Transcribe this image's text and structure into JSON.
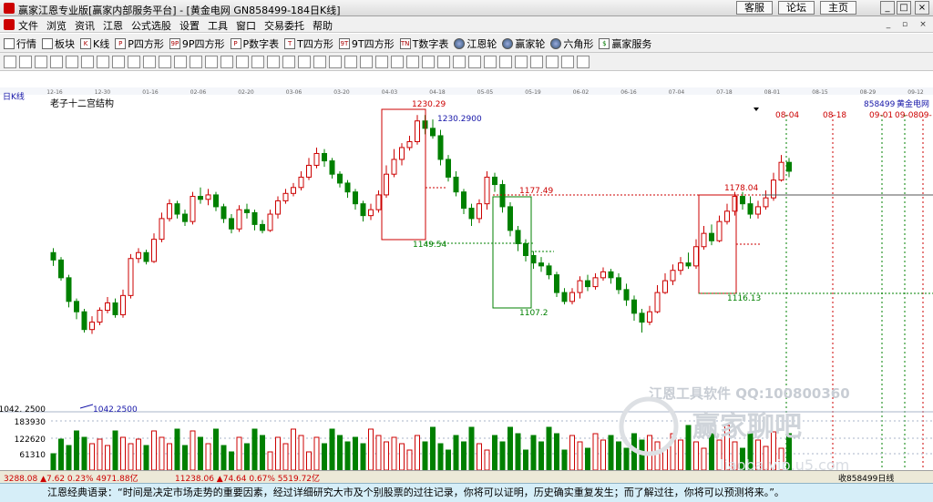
{
  "window": {
    "title": "赢家江恩专业版[赢家内部服务平台] - [黄金电网  GN858499-184日K线]",
    "links": [
      "客服",
      "论坛",
      "主页"
    ],
    "controls": [
      "_",
      "□",
      "×"
    ]
  },
  "menu": {
    "items": [
      "文件",
      "浏览",
      "资讯",
      "江恩",
      "公式选股",
      "设置",
      "工具",
      "窗口",
      "交易委托",
      "帮助"
    ],
    "controls": [
      "_",
      "▫",
      "×"
    ]
  },
  "toolbar": {
    "items": [
      {
        "icon": "grid-icon",
        "label": "行情"
      },
      {
        "icon": "grid-icon",
        "label": "板块"
      },
      {
        "icon": "kline-icon",
        "label": "K线"
      },
      {
        "icon": "p-square-icon",
        "label": "P四方形"
      },
      {
        "icon": "9p-square-icon",
        "label": "9P四方形"
      },
      {
        "icon": "p-digit-icon",
        "label": "P数字表"
      },
      {
        "icon": "t-square-icon",
        "label": "T四方形"
      },
      {
        "icon": "9t-square-icon",
        "label": "9T四方形"
      },
      {
        "icon": "tn-digit-icon",
        "label": "T数字表"
      },
      {
        "icon": "wheel-icon",
        "label": "江恩轮"
      },
      {
        "icon": "wheel-icon",
        "label": "赢家轮"
      },
      {
        "icon": "hexagon-icon",
        "label": "六角形"
      },
      {
        "icon": "dollar-icon",
        "label": "赢家服务"
      }
    ]
  },
  "chart": {
    "period_label": "日K线",
    "pattern_label": "老子十二宫结构",
    "symbol": "858499",
    "name": "黄金电网",
    "top_dates": [
      "12-16",
      "12-30",
      "01-16",
      "02-06",
      "02-20",
      "03-06",
      "03-20",
      "04-03",
      "04-18",
      "05-05",
      "05-19",
      "06-02",
      "06-16",
      "07-04",
      "07-18",
      "08-01",
      "08-15",
      "08-29",
      "09-12"
    ],
    "future_dates": [
      "08-04",
      "08-18",
      "09-01",
      "09-08",
      "09-"
    ],
    "price_labels": {
      "high": "1230.29",
      "high2": "1230.2900",
      "low1": "1149.54",
      "mid": "1177.49",
      "low2": "1107.2",
      "right_high": "1178.04",
      "right_low": "1116.13",
      "bottom": "1042.2500",
      "bottom_axis": "1042. 2500"
    },
    "volume_axis": [
      "183930",
      "122620",
      "61310"
    ],
    "watermark": [
      "江恩工具软件  QQ:100800360",
      "赢家聊吧",
      "liaoba.vip.u5.com"
    ]
  },
  "statusbar": {
    "index1": "3288.08 ▲7.62 0.23% 4971.88亿",
    "index2": "11238.06 ▲74.64 0.67% 5519.72亿",
    "right": "收858499日线"
  },
  "quote": {
    "text": "江恩经典语录：“时间是决定市场走势的重要因素，经过详细研究大市及个别股票的过往记录，你将可以证明，历史确实重复发生；而了解过往，你将可以预测将来。”。"
  },
  "colors": {
    "up": "#cc0000",
    "down": "#008000",
    "grid": "#aab4c8",
    "highlight": "#1515a8"
  },
  "chart_data": {
    "type": "candlestick",
    "series": [
      {
        "name": "K线",
        "values": [
          [
            1137,
            1132,
            1140,
            1128
          ],
          [
            1132,
            1120,
            1134,
            1118
          ],
          [
            1120,
            1104,
            1122,
            1100
          ],
          [
            1104,
            1097,
            1106,
            1092
          ],
          [
            1097,
            1085,
            1099,
            1083
          ],
          [
            1085,
            1090,
            1094,
            1082
          ],
          [
            1090,
            1098,
            1100,
            1088
          ],
          [
            1098,
            1103,
            1107,
            1096
          ],
          [
            1103,
            1095,
            1106,
            1093
          ],
          [
            1095,
            1108,
            1112,
            1093
          ],
          [
            1108,
            1133,
            1136,
            1106
          ],
          [
            1133,
            1137,
            1140,
            1130
          ],
          [
            1137,
            1131,
            1139,
            1129
          ],
          [
            1131,
            1146,
            1150,
            1130
          ],
          [
            1146,
            1160,
            1164,
            1144
          ],
          [
            1160,
            1170,
            1173,
            1158
          ],
          [
            1170,
            1163,
            1172,
            1160
          ],
          [
            1163,
            1158,
            1166,
            1155
          ],
          [
            1158,
            1175,
            1178,
            1156
          ],
          [
            1175,
            1173,
            1181,
            1170
          ],
          [
            1173,
            1176,
            1180,
            1169
          ],
          [
            1176,
            1168,
            1178,
            1165
          ],
          [
            1168,
            1160,
            1170,
            1157
          ],
          [
            1160,
            1153,
            1163,
            1150
          ],
          [
            1153,
            1166,
            1169,
            1151
          ],
          [
            1166,
            1164,
            1170,
            1160
          ],
          [
            1164,
            1156,
            1166,
            1152
          ],
          [
            1156,
            1152,
            1159,
            1150
          ],
          [
            1152,
            1163,
            1166,
            1151
          ],
          [
            1163,
            1172,
            1175,
            1160
          ],
          [
            1172,
            1177,
            1180,
            1170
          ],
          [
            1177,
            1181,
            1184,
            1175
          ],
          [
            1181,
            1188,
            1192,
            1179
          ],
          [
            1188,
            1196,
            1201,
            1186
          ],
          [
            1196,
            1204,
            1208,
            1194
          ],
          [
            1204,
            1199,
            1207,
            1195
          ],
          [
            1199,
            1190,
            1201,
            1187
          ],
          [
            1190,
            1184,
            1192,
            1181
          ],
          [
            1184,
            1178,
            1186,
            1174
          ],
          [
            1178,
            1170,
            1180,
            1166
          ],
          [
            1170,
            1162,
            1172,
            1158
          ],
          [
            1162,
            1166,
            1170,
            1159
          ],
          [
            1166,
            1176,
            1179,
            1164
          ],
          [
            1176,
            1190,
            1196,
            1174
          ],
          [
            1190,
            1200,
            1207,
            1188
          ],
          [
            1200,
            1208,
            1211,
            1196
          ],
          [
            1208,
            1212,
            1216,
            1206
          ],
          [
            1212,
            1226,
            1230,
            1210
          ],
          [
            1226,
            1221,
            1230,
            1217
          ],
          [
            1221,
            1216,
            1227,
            1214
          ],
          [
            1216,
            1200,
            1220,
            1196
          ],
          [
            1200,
            1188,
            1203,
            1185
          ],
          [
            1188,
            1178,
            1192,
            1175
          ],
          [
            1178,
            1167,
            1180,
            1163
          ],
          [
            1167,
            1160,
            1170,
            1155
          ],
          [
            1160,
            1170,
            1173,
            1157
          ],
          [
            1170,
            1188,
            1192,
            1166
          ],
          [
            1188,
            1183,
            1191,
            1178
          ],
          [
            1183,
            1168,
            1186,
            1164
          ],
          [
            1168,
            1152,
            1171,
            1148
          ],
          [
            1152,
            1143,
            1155,
            1138
          ],
          [
            1143,
            1135,
            1146,
            1131
          ],
          [
            1135,
            1130,
            1138,
            1126
          ],
          [
            1130,
            1128,
            1134,
            1124
          ],
          [
            1128,
            1122,
            1130,
            1119
          ],
          [
            1122,
            1110,
            1124,
            1107
          ],
          [
            1110,
            1104,
            1113,
            1102
          ],
          [
            1104,
            1110,
            1113,
            1102
          ],
          [
            1110,
            1118,
            1121,
            1106
          ],
          [
            1118,
            1114,
            1122,
            1111
          ],
          [
            1114,
            1120,
            1123,
            1112
          ],
          [
            1120,
            1124,
            1127,
            1118
          ],
          [
            1124,
            1120,
            1126,
            1116
          ],
          [
            1120,
            1112,
            1123,
            1109
          ],
          [
            1112,
            1105,
            1116,
            1101
          ],
          [
            1105,
            1096,
            1108,
            1091
          ],
          [
            1096,
            1090,
            1099,
            1083
          ],
          [
            1090,
            1097,
            1101,
            1088
          ],
          [
            1097,
            1110,
            1115,
            1096
          ],
          [
            1110,
            1118,
            1123,
            1109
          ],
          [
            1118,
            1125,
            1129,
            1115
          ],
          [
            1125,
            1130,
            1134,
            1122
          ],
          [
            1130,
            1128,
            1137,
            1126
          ],
          [
            1128,
            1141,
            1146,
            1126
          ],
          [
            1141,
            1150,
            1155,
            1139
          ],
          [
            1150,
            1145,
            1156,
            1142
          ],
          [
            1145,
            1158,
            1162,
            1144
          ],
          [
            1158,
            1165,
            1170,
            1156
          ],
          [
            1165,
            1175,
            1178,
            1162
          ],
          [
            1175,
            1170,
            1178,
            1166
          ],
          [
            1170,
            1163,
            1175,
            1160
          ],
          [
            1163,
            1168,
            1172,
            1160
          ],
          [
            1168,
            1174,
            1179,
            1166
          ],
          [
            1174,
            1186,
            1191,
            1172
          ],
          [
            1186,
            1198,
            1203,
            1185
          ],
          [
            1198,
            1192,
            1201,
            1188
          ]
        ]
      }
    ]
  }
}
